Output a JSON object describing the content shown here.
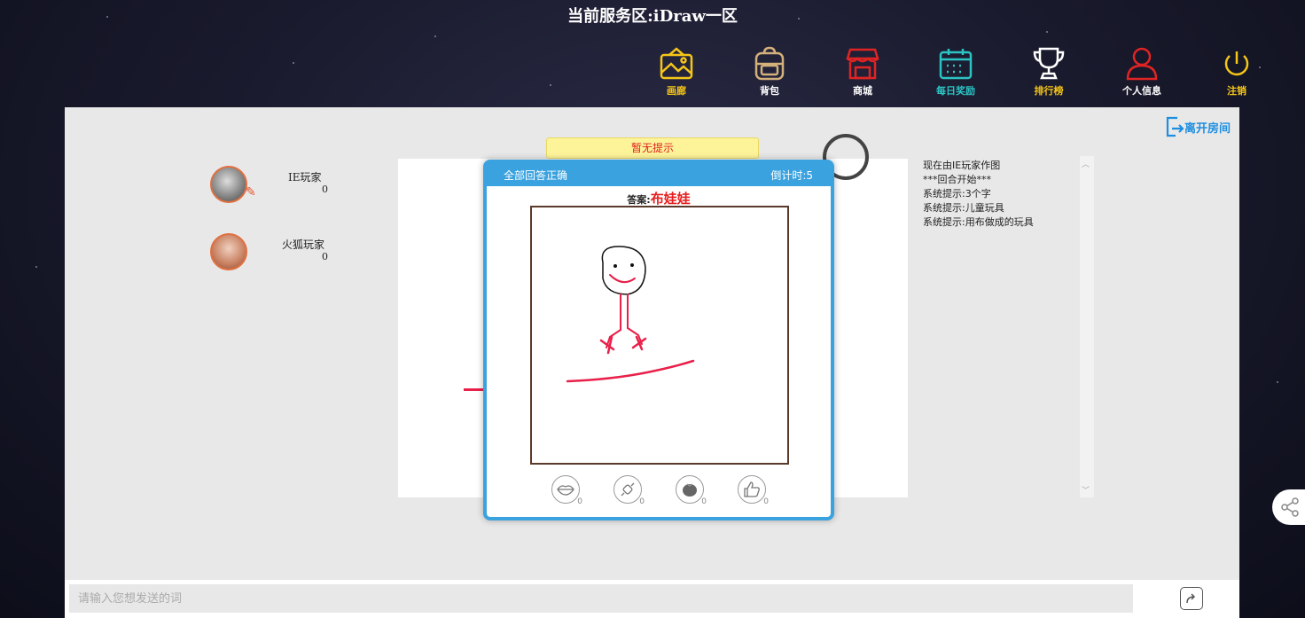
{
  "header": {
    "server_title": "当前服务区:iDraw一区"
  },
  "nav": {
    "items": [
      {
        "label": "画廊",
        "color": "#f5c518",
        "icon": "gallery-icon"
      },
      {
        "label": "背包",
        "color": "#d4b07a",
        "icon": "backpack-icon"
      },
      {
        "label": "商城",
        "color": "#e02424",
        "icon": "shop-icon"
      },
      {
        "label": "每日奖励",
        "color": "#2cc3c3",
        "icon": "calendar-icon"
      },
      {
        "label": "排行榜",
        "color": "#f5c518",
        "icon": "trophy-icon"
      },
      {
        "label": "个人信息",
        "color": "#e02424",
        "icon": "user-icon"
      },
      {
        "label": "注销",
        "color": "#f5c518",
        "icon": "power-icon"
      }
    ]
  },
  "room": {
    "leave_label": "离开房间",
    "hint": "暂无提示"
  },
  "players": [
    {
      "name": "IE玩家",
      "score": "0",
      "is_drawer": true
    },
    {
      "name": "火狐玩家",
      "score": "0",
      "is_drawer": false
    }
  ],
  "chat": {
    "messages": [
      "现在由IE玩家作图",
      "***回合开始***",
      "系统提示:3个字",
      "系统提示:儿童玩具",
      "系统提示:用布做成的玩具"
    ],
    "input_placeholder": "请输入您想发送的词"
  },
  "result_modal": {
    "header_left": "全部回答正确",
    "header_right": "倒计时:5",
    "answer_label": "答案:",
    "answer_value": "布娃娃",
    "reactions": [
      {
        "icon": "lips-icon",
        "count": "0"
      },
      {
        "icon": "candy-icon",
        "count": "0"
      },
      {
        "icon": "tomato-icon",
        "count": "0"
      },
      {
        "icon": "thumbs-up-icon",
        "count": "0"
      }
    ]
  },
  "colors": {
    "accent": "#3aa2df",
    "answer_red": "#e81e1e",
    "stroke_red": "#e8204a"
  }
}
